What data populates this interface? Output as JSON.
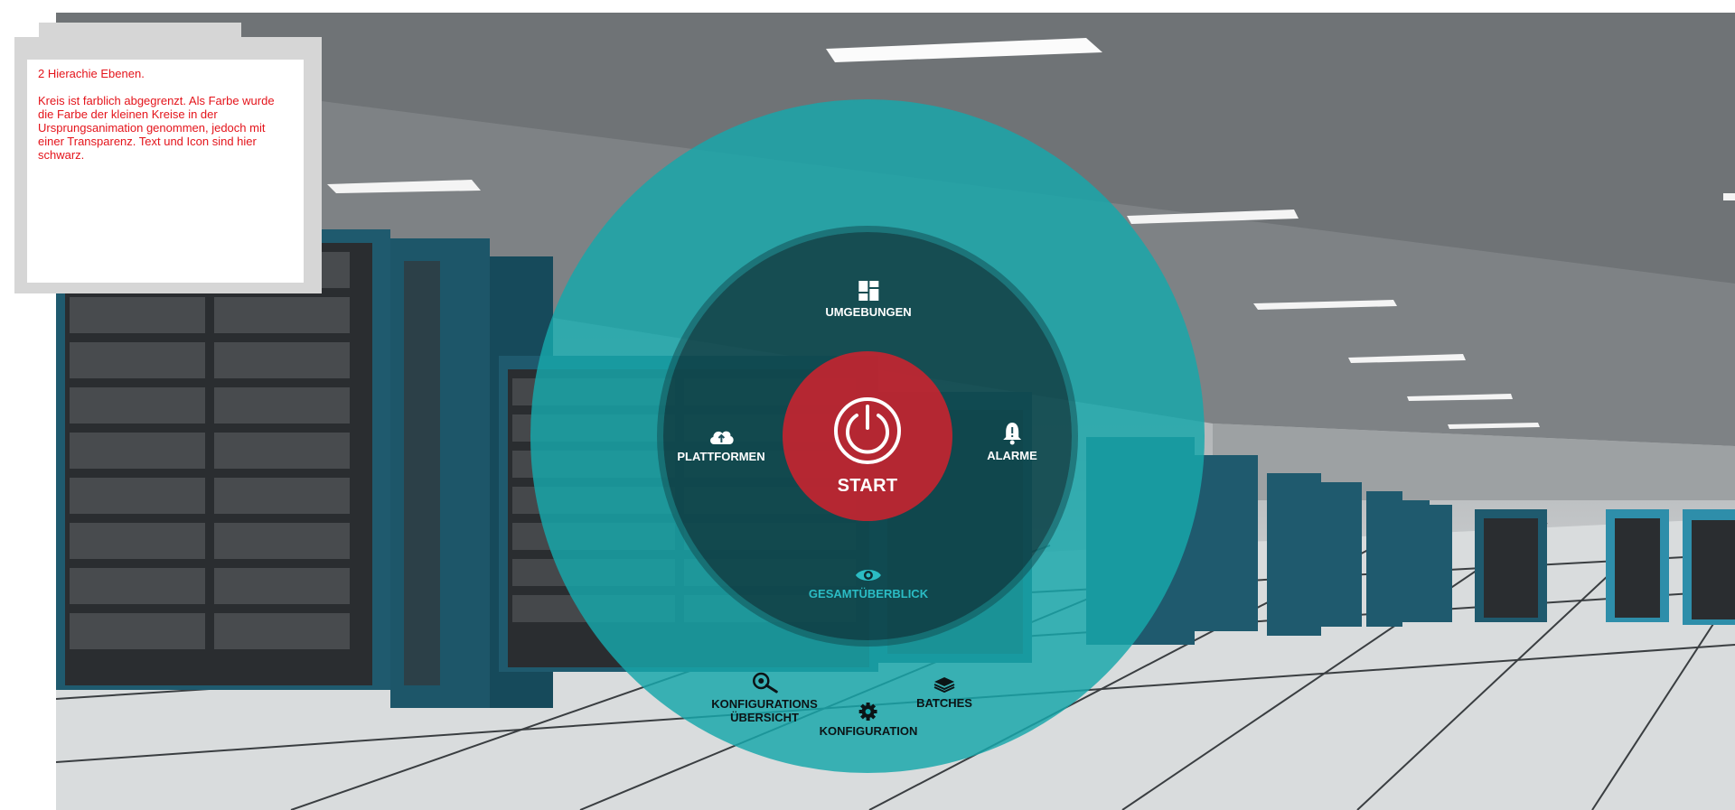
{
  "note": {
    "line1": "2 Hierachie Ebenen.",
    "line2": "Kreis ist farblich abgegrenzt. Als Farbe wurde die Farbe der kleinen Kreise in der Ursprungsanimation genommen, jedoch mit einer Transparenz. Text und Icon sind hier schwarz."
  },
  "menu": {
    "start": {
      "label": "START",
      "icon": "power-icon"
    },
    "inner": [
      {
        "label": "UMGEBUNGEN",
        "icon": "grid-icon"
      },
      {
        "label": "PLATTFORMEN",
        "icon": "cloud-upload-icon"
      },
      {
        "label": "ALARME",
        "icon": "bell-alert-icon"
      },
      {
        "label": "GESAMTÜBERBLICK",
        "icon": "eye-icon",
        "state": "active"
      }
    ],
    "outer": [
      {
        "label_line1": "KONFIGURATIONS",
        "label_line2": "ÜBERSICHT",
        "icon": "search-settings-icon"
      },
      {
        "label": "KONFIGURATION",
        "icon": "gear-icon"
      },
      {
        "label": "BATCHES",
        "icon": "layers-icon"
      }
    ]
  },
  "colors": {
    "outer_ring": "#17a7ab",
    "start_circle": "#d6202d",
    "note_text": "#e4141b",
    "active_item": "#2bbcc4"
  }
}
